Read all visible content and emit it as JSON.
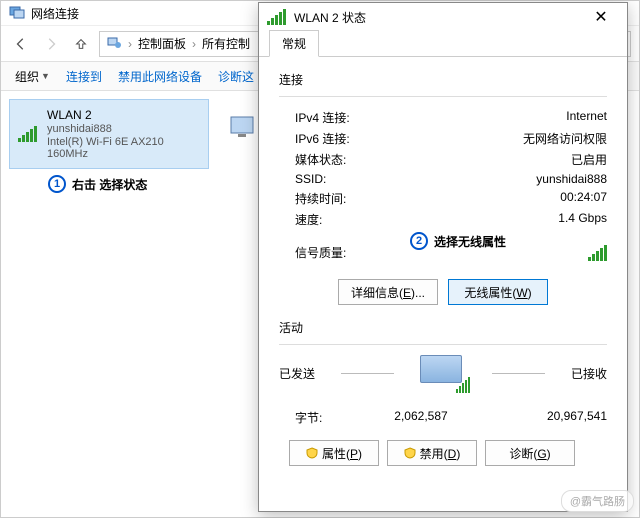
{
  "main": {
    "title": "网络连接",
    "breadcrumb": {
      "a": "控制面板",
      "b": "所有控制"
    },
    "toolbar": {
      "org": "组织",
      "connect": "连接到",
      "disable": "禁用此网络设备",
      "diagnose": "诊断这"
    },
    "adapter": {
      "name": "WLAN 2",
      "ssid": "yunshidai888",
      "device": "Intel(R) Wi-Fi 6E AX210 160MHz"
    }
  },
  "status": {
    "title": "WLAN 2 状态",
    "tab": "常规",
    "section_connection": "连接",
    "kv": {
      "ipv4": {
        "k": "IPv4 连接:",
        "v": "Internet"
      },
      "ipv6": {
        "k": "IPv6 连接:",
        "v": "无网络访问权限"
      },
      "media": {
        "k": "媒体状态:",
        "v": "已启用"
      },
      "ssid": {
        "k": "SSID:",
        "v": "yunshidai888"
      },
      "duration": {
        "k": "持续时间:",
        "v": "00:24:07"
      },
      "speed": {
        "k": "速度:",
        "v": "1.4 Gbps"
      },
      "signal": "信号质量:"
    },
    "btns": {
      "details": "详细信息(E)...",
      "wireless": "无线属性(W)"
    },
    "section_activity": "活动",
    "activity": {
      "sent": "已发送",
      "recv": "已接收",
      "bytes_label": "字节:",
      "sent_v": "2,062,587",
      "recv_v": "20,967,541"
    },
    "bottom": {
      "properties": "属性(P)",
      "disable": "禁用(D)",
      "diagnose": "诊断(G)"
    }
  },
  "annot": {
    "a1": "右击 选择状态",
    "a2": "选择无线属性"
  },
  "watermark": "@霸气路肠"
}
